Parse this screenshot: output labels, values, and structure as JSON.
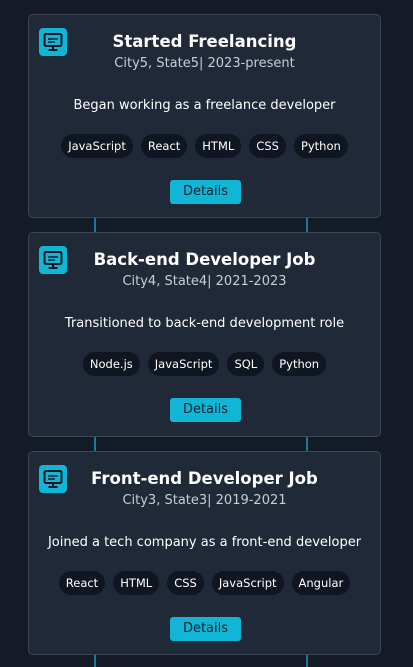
{
  "timeline": {
    "entries": [
      {
        "icon": "monitor-icon",
        "title": "Started Freelancing",
        "subtitle": "City5, State5| 2023-present",
        "description": "Began working as a freelance developer",
        "tags": [
          "JavaScript",
          "React",
          "HTML",
          "CSS",
          "Python"
        ],
        "button_label": "Details"
      },
      {
        "icon": "monitor-icon",
        "title": "Back-end Developer Job",
        "subtitle": "City4, State4| 2021-2023",
        "description": "Transitioned to back-end development role",
        "tags": [
          "Node.js",
          "JavaScript",
          "SQL",
          "Python"
        ],
        "button_label": "Details"
      },
      {
        "icon": "monitor-icon",
        "title": "Front-end Developer Job",
        "subtitle": "City3, State3| 2019-2021",
        "description": "Joined a tech company as a front-end developer",
        "tags": [
          "React",
          "HTML",
          "CSS",
          "JavaScript",
          "Angular"
        ],
        "button_label": "Details"
      }
    ]
  },
  "colors": {
    "background": "#141b26",
    "card": "#1f2937",
    "accent": "#11b5d6",
    "tag_bg": "#0f1621"
  }
}
